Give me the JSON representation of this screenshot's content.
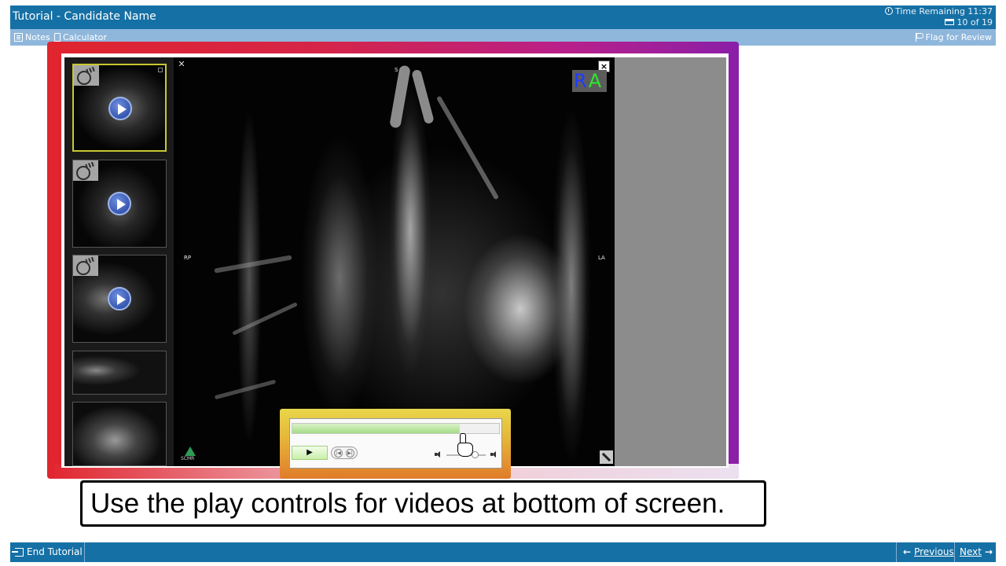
{
  "window": {
    "title": "Tutorial - Candidate Name",
    "time_remaining": "Time Remaining 11:37",
    "progress": "10 of 19"
  },
  "toolbar": {
    "notes_label": "Notes",
    "calculator_label": "Calculator",
    "flag_label": "Flag for Review"
  },
  "viewer": {
    "orientation": {
      "top": "S",
      "left": "RP",
      "right": "LA"
    },
    "ra_badge": {
      "r": "R",
      "a": "A"
    },
    "close_symbol": "×",
    "collapse_symbol": "✕",
    "thumbnails": [
      {
        "type": "video",
        "selected": true
      },
      {
        "type": "video",
        "selected": false
      },
      {
        "type": "video",
        "selected": false
      },
      {
        "type": "image",
        "selected": false
      },
      {
        "type": "image",
        "selected": false
      }
    ]
  },
  "player": {
    "play_symbol": "▶",
    "progress_fraction": 0.81,
    "volume_fraction": 0.72
  },
  "caption": {
    "text": "Use the play controls for videos at bottom of screen."
  },
  "footer": {
    "end_label": "End Tutorial",
    "previous_label": "Previous",
    "next_label": "Next"
  },
  "colors": {
    "header": "#1570a5",
    "toolbar": "#8fb7dc",
    "highlight_red": "#e0252e",
    "highlight_purple": "#8a1fa8",
    "player_highlight": "#e6b83a"
  }
}
